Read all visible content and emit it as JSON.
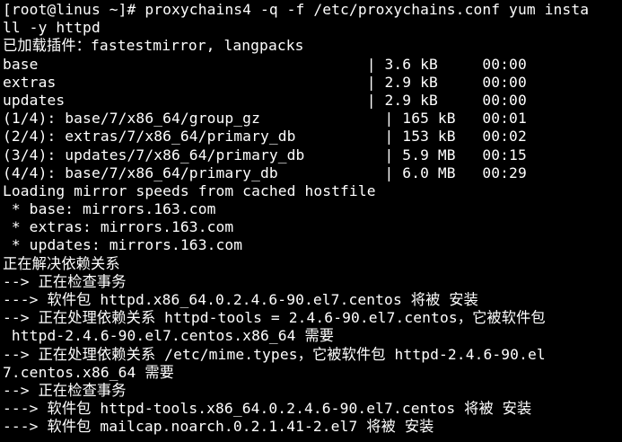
{
  "terminal": {
    "lines": [
      "[root@linus ~]# proxychains4 -q -f /etc/proxychains.conf yum insta",
      "ll -y httpd",
      "已加载插件：fastestmirror, langpacks",
      "base                                     | 3.6 kB     00:00",
      "extras                                   | 2.9 kB     00:00",
      "updates                                  | 2.9 kB     00:00",
      "(1/4): base/7/x86_64/group_gz              | 165 kB   00:01",
      "(2/4): extras/7/x86_64/primary_db          | 153 kB   00:02",
      "(3/4): updates/7/x86_64/primary_db         | 5.9 MB   00:15",
      "(4/4): base/7/x86_64/primary_db            | 6.0 MB   00:29",
      "Loading mirror speeds from cached hostfile",
      " * base: mirrors.163.com",
      " * extras: mirrors.163.com",
      " * updates: mirrors.163.com",
      "正在解决依赖关系",
      "--> 正在检查事务",
      "---> 软件包 httpd.x86_64.0.2.4.6-90.el7.centos 将被 安装",
      "--> 正在处理依赖关系 httpd-tools = 2.4.6-90.el7.centos，它被软件包",
      " httpd-2.4.6-90.el7.centos.x86_64 需要",
      "--> 正在处理依赖关系 /etc/mime.types，它被软件包 httpd-2.4.6-90.el",
      "7.centos.x86_64 需要",
      "--> 正在检查事务",
      "---> 软件包 httpd-tools.x86_64.0.2.4.6-90.el7.centos 将被 安装",
      "---> 软件包 mailcap.noarch.0.2.1.41-2.el7 将被 安装"
    ]
  }
}
